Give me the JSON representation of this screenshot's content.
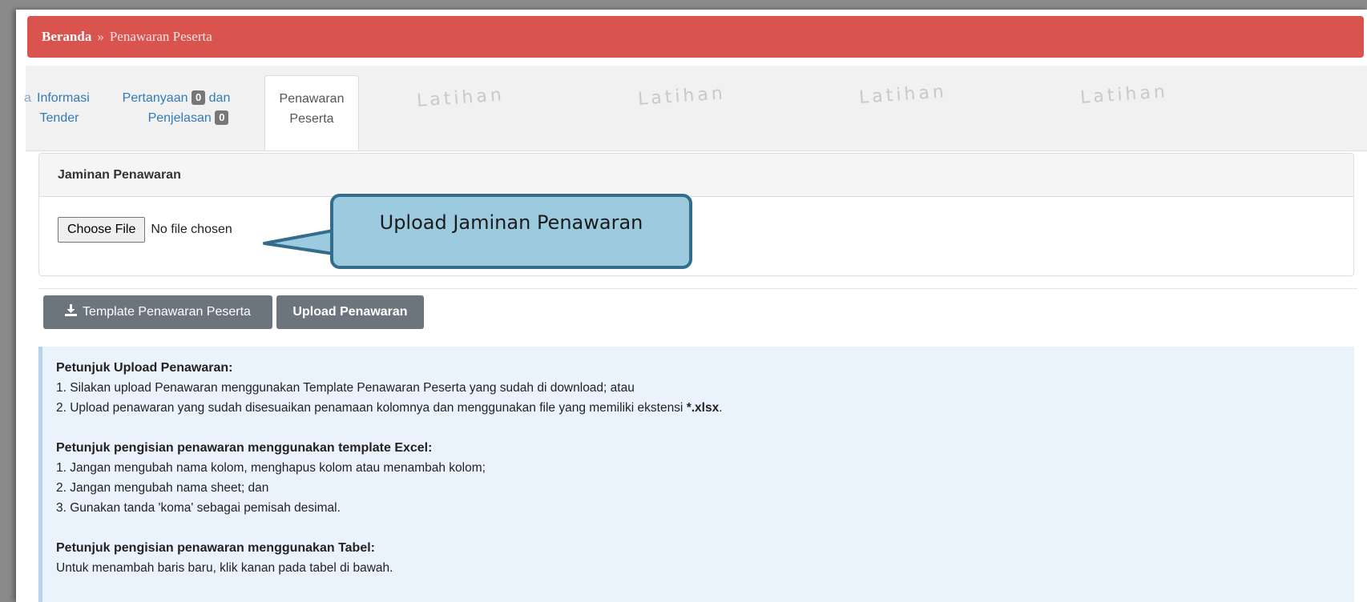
{
  "breadcrumb": {
    "home": "Beranda",
    "separator": "»",
    "current": "Penawaran Peserta"
  },
  "watermark_text": "Latihan",
  "tabs": {
    "informasi_line1": "Informasi",
    "informasi_line2": "Tender",
    "pertanyaan_word": "Pertanyaan",
    "pertanyaan_badge": "0",
    "dan_word": "dan",
    "penjelasan_word": "Penjelasan",
    "penjelasan_badge": "0",
    "penawaran_line1": "Penawaran",
    "penawaran_line2": "Peserta",
    "partial_text": "a"
  },
  "jaminan_panel": {
    "title": "Jaminan Penawaran",
    "choose_file_label": "Choose File",
    "file_status": "No file chosen"
  },
  "callout": {
    "text": "Upload Jaminan Penawaran"
  },
  "buttons": {
    "template_label": "Template Penawaran Peserta",
    "upload_label": "Upload Penawaran"
  },
  "info": {
    "upload_heading": "Petunjuk Upload Penawaran:",
    "upload_step1": "1. Silakan upload Penawaran menggunakan Template Penawaran Peserta yang sudah di download; atau",
    "upload_step2_prefix": "2. Upload penawaran yang sudah disesuaikan penamaan kolomnya dan menggunakan file yang memiliki ekstensi",
    "upload_step2_ext": "*.xlsx",
    "upload_step2_suffix": ".",
    "excel_heading": "Petunjuk pengisian penawaran menggunakan template Excel:",
    "excel_step1": "1. Jangan mengubah nama kolom, menghapus kolom atau menambah kolom;",
    "excel_step2": "2. Jangan mengubah nama sheet; dan",
    "excel_step3": "3. Gunakan tanda 'koma' sebagai pemisah desimal.",
    "table_heading": "Petunjuk pengisian penawaran menggunakan Tabel:",
    "table_text": "Untuk menambah baris baru, klik kanan pada tabel di bawah."
  },
  "colors": {
    "breadcrumb_bg": "#d9534f",
    "button_bg": "#6c757d",
    "info_bg": "#eaf2fb",
    "callout_bg": "#9ccbe0",
    "callout_border": "#336c8c",
    "link": "#337ab7"
  },
  "icons": {
    "template_button_icon": "download-icon"
  }
}
